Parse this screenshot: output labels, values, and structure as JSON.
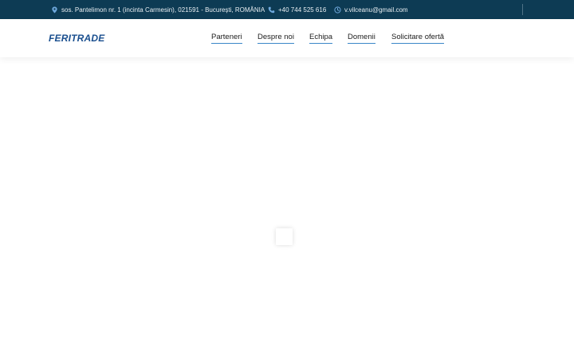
{
  "topbar": {
    "address": "sos. Pantelimon nr. 1 (incinta Carmesin), 021591 - București, ROMÂNIA",
    "phone": "+40 744 525 616",
    "email": "v.vilceanu@gmail.com",
    "icons": {
      "address": "map-pin-icon",
      "phone": "phone-icon",
      "email": "clock-icon"
    },
    "background": "#0d3b54"
  },
  "header": {
    "logo": "FERITRADE",
    "logo_color": "#1a4f8f",
    "nav": [
      {
        "label": "Parteneri"
      },
      {
        "label": "Despre noi"
      },
      {
        "label": "Echipa"
      },
      {
        "label": "Domenii"
      },
      {
        "label": "Solicitare ofertă"
      }
    ],
    "nav_underline_color": "#3a86c8"
  }
}
